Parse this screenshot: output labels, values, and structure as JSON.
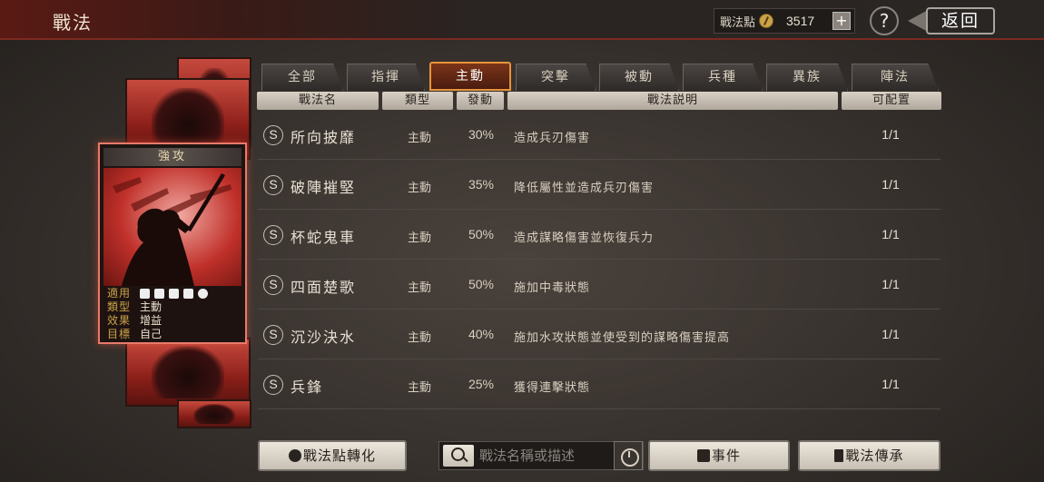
{
  "header": {
    "title": "戰法",
    "points_label": "戰法點",
    "points_value": "3517",
    "plus_label": "+",
    "help_label": "?",
    "back_label": "返回"
  },
  "card": {
    "name": "強攻",
    "info": [
      {
        "key": "適用",
        "value": ""
      },
      {
        "key": "類型",
        "value": "主動"
      },
      {
        "key": "效果",
        "value": "增益"
      },
      {
        "key": "目標",
        "value": "自己"
      }
    ],
    "troop_icons": [
      "cavalry-icon",
      "shield-icon",
      "bow-icon",
      "spear-icon",
      "siege-wheel-icon"
    ]
  },
  "tabs": [
    {
      "label": "全部",
      "active": false
    },
    {
      "label": "指揮",
      "active": false
    },
    {
      "label": "主動",
      "active": true
    },
    {
      "label": "突擊",
      "active": false
    },
    {
      "label": "被動",
      "active": false
    },
    {
      "label": "兵種",
      "active": false
    },
    {
      "label": "異族",
      "active": false
    },
    {
      "label": "陣法",
      "active": false
    }
  ],
  "table": {
    "headers": {
      "name": "戰法名",
      "type": "類型",
      "rate": "發動",
      "desc": "戰法説明",
      "slots": "可配置"
    },
    "rows": [
      {
        "grade": "S",
        "name": "所向披靡",
        "type": "主動",
        "rate": "30%",
        "desc": "造成兵刃傷害",
        "slots": "1/1"
      },
      {
        "grade": "S",
        "name": "破陣摧堅",
        "type": "主動",
        "rate": "35%",
        "desc": "降低屬性並造成兵刃傷害",
        "slots": "1/1"
      },
      {
        "grade": "S",
        "name": "杯蛇鬼車",
        "type": "主動",
        "rate": "50%",
        "desc": "造成謀略傷害並恢復兵力",
        "slots": "1/1"
      },
      {
        "grade": "S",
        "name": "四面楚歌",
        "type": "主動",
        "rate": "50%",
        "desc": "施加中毒狀態",
        "slots": "1/1"
      },
      {
        "grade": "S",
        "name": "沉沙決水",
        "type": "主動",
        "rate": "40%",
        "desc": "施加水攻狀態並使受到的謀略傷害提高",
        "slots": "1/1"
      },
      {
        "grade": "S",
        "name": "兵鋒",
        "type": "主動",
        "rate": "25%",
        "desc": "獲得連擊狀態",
        "slots": "1/1"
      }
    ]
  },
  "bottom": {
    "convert_label": "戰法點轉化",
    "search_placeholder": "戰法名稱或描述",
    "event_label": "事件",
    "inherit_label": "戰法傳承"
  },
  "colors": {
    "active_tab_border": "#e8943a",
    "card_border": "#e87a6a",
    "accent_red": "#8a1e18"
  }
}
